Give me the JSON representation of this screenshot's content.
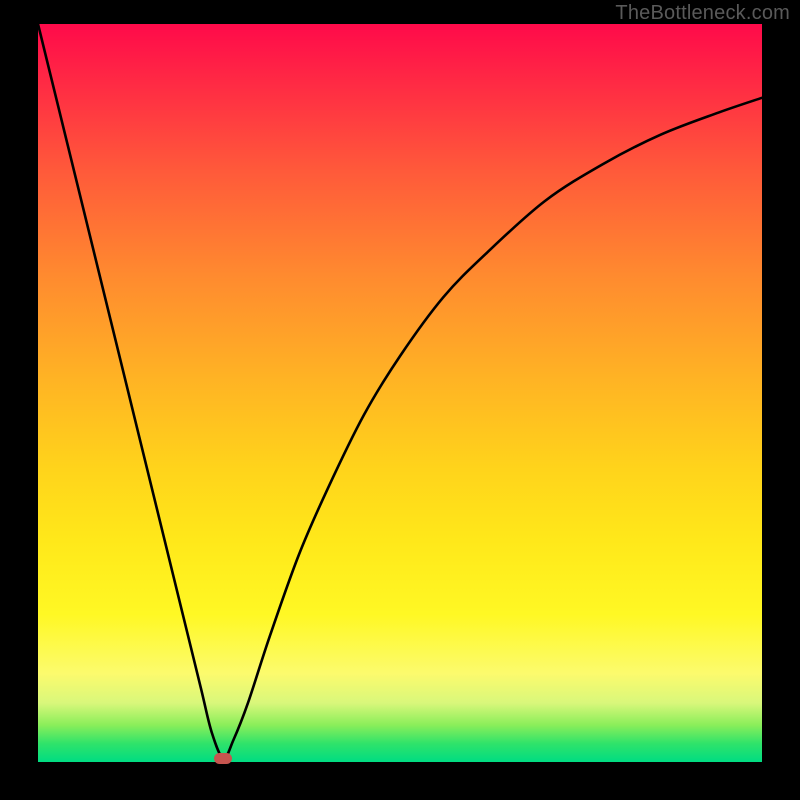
{
  "watermark": "TheBottleneck.com",
  "chart_data": {
    "type": "line",
    "title": "",
    "xlabel": "",
    "ylabel": "",
    "xlim": [
      0,
      100
    ],
    "ylim": [
      0,
      100
    ],
    "series": [
      {
        "name": "bottleneck-curve",
        "x": [
          0,
          4,
          8,
          12,
          16,
          20,
          22.5,
          24,
          25.6,
          27,
          29,
          32,
          36,
          40,
          45,
          50,
          56,
          62,
          70,
          78,
          86,
          94,
          100
        ],
        "y": [
          100,
          84,
          68,
          52,
          36,
          20,
          10,
          4,
          0.5,
          3,
          8,
          17,
          28,
          37,
          47,
          55,
          63,
          69,
          76,
          81,
          85,
          88,
          90
        ]
      }
    ],
    "marker": {
      "x": 25.6,
      "y": 0.5,
      "color": "#c6554f"
    },
    "gradient_stops": [
      {
        "pos": 0,
        "color": "#ff0a4a"
      },
      {
        "pos": 0.5,
        "color": "#ffd31b"
      },
      {
        "pos": 0.88,
        "color": "#fcfb6d"
      },
      {
        "pos": 1.0,
        "color": "#00dc82"
      }
    ]
  }
}
